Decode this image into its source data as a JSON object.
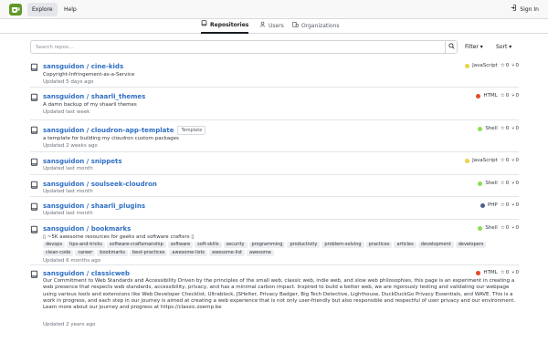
{
  "nav": {
    "explore": "Explore",
    "help": "Help",
    "signin": "Sign In"
  },
  "tabs": [
    {
      "label": "Repositories",
      "icon": "repo-icon"
    },
    {
      "label": "Users",
      "icon": "person-icon"
    },
    {
      "label": "Organizations",
      "icon": "organization-icon"
    }
  ],
  "search": {
    "placeholder": "Search repos...",
    "value": ""
  },
  "filter_label": "Filter",
  "sort_label": "Sort",
  "repos": [
    {
      "owner": "sansguidon",
      "name": "cine-kids",
      "description": "Copyright-Infringement-as-a-Service",
      "updated": "Updated 5 days ago",
      "language": "JavaScript",
      "lang_color": "#e8d44d",
      "stars": "0",
      "forks": "0"
    },
    {
      "owner": "sansguidon",
      "name": "shaarli_themes",
      "description": "A damn backup of my shaarli themes",
      "updated": "Updated last week",
      "language": "HTML",
      "lang_color": "#e34c26",
      "stars": "0",
      "forks": "0"
    },
    {
      "owner": "sansguidon",
      "name": "cloudron-app-template",
      "tag": "Template",
      "description": "a template for building my cloudron custom packages",
      "updated": "Updated 2 weeks ago",
      "language": "Shell",
      "lang_color": "#89e051",
      "stars": "0",
      "forks": "0"
    },
    {
      "owner": "sansguidon",
      "name": "snippets",
      "updated": "Updated last month",
      "language": "JavaScript",
      "lang_color": "#e8d44d",
      "stars": "0",
      "forks": "0"
    },
    {
      "owner": "sansguidon",
      "name": "soulseek-cloudron",
      "updated": "Updated last month",
      "language": "Shell",
      "lang_color": "#89e051",
      "stars": "0",
      "forks": "0"
    },
    {
      "owner": "sansguidon",
      "name": "shaarli_plugins",
      "updated": "Updated last month",
      "language": "PHP",
      "lang_color": "#4f5d95",
      "stars": "0",
      "forks": "0"
    },
    {
      "owner": "sansguidon",
      "name": "bookmarks",
      "description": "▯ ~5K awesome resources for geeks and software crafters ▯",
      "topics": [
        "devops",
        "tips-and-tricks",
        "software-craftsmanship",
        "software",
        "soft-skills",
        "security",
        "programming",
        "productivity",
        "problem-solving",
        "practices",
        "articles",
        "development",
        "developers",
        "clean-code",
        "career",
        "bookmarks",
        "best-practices",
        "awesome-lists",
        "awesome-list",
        "awesome"
      ],
      "updated": "Updated 6 months ago",
      "language": "Shell",
      "lang_color": "#89e051",
      "stars": "0",
      "forks": "0"
    },
    {
      "owner": "sansguidon",
      "name": "classicweb",
      "description": "Our Commitment to Web Standards and Accessibility Driven by the principles of the small web, classic web, indie web, and slow web philosophies, this page is an experiment in creating a web presence that respects web standards, accessibility, privacy, and has a minimal carbon impact. Inspired to build a better web, we are rigorously testing and validating our webpage using various tools and extensions like Web Developer Checklist, Ultrablock, JSHelter, Privacy Badger, Big Tech Detective, Lighthouse, DuckDuckGo Privacy Essentials, and WAVE. This is a work in progress, and each step in our journey is aimed at creating a web experience that is not only user-friendly but also responsible and respectful of user privacy and our environment. Learn more about our journey and progress at https://classic.zoemp.be",
      "updated": "Updated 2 years ago",
      "language": "HTML",
      "lang_color": "#e34c26",
      "stars": "0",
      "forks": "0"
    }
  ]
}
